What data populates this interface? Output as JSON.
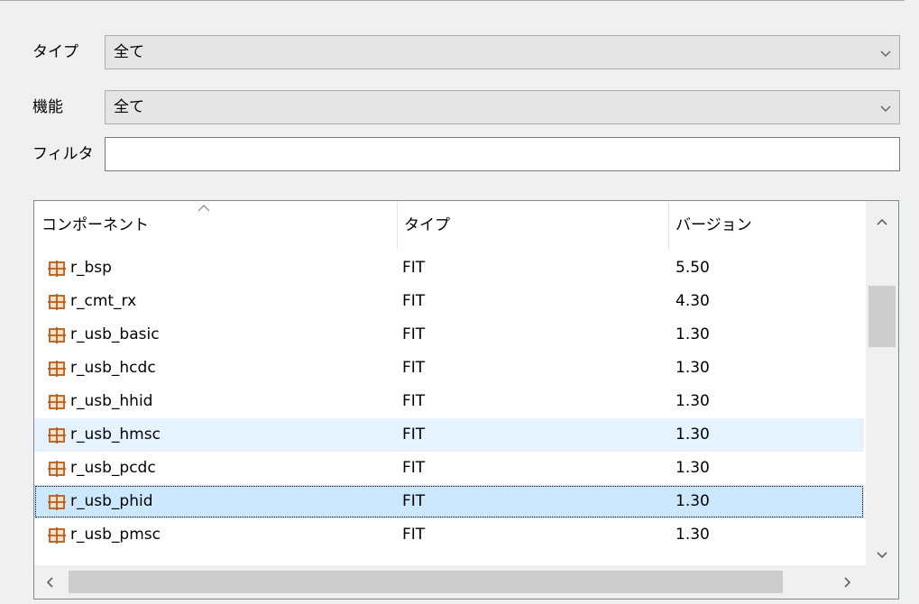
{
  "filters": {
    "type_label": "タイプ",
    "type_value": "全て",
    "function_label": "機能",
    "function_value": "全て",
    "filter_label": "フィルタ",
    "filter_value": ""
  },
  "table": {
    "columns": [
      "コンポーネント",
      "タイプ",
      "バージョン"
    ],
    "rows": [
      {
        "name": "r_bsp",
        "type": "FIT",
        "version": "5.50"
      },
      {
        "name": "r_cmt_rx",
        "type": "FIT",
        "version": "4.30"
      },
      {
        "name": "r_usb_basic",
        "type": "FIT",
        "version": "1.30"
      },
      {
        "name": "r_usb_hcdc",
        "type": "FIT",
        "version": "1.30"
      },
      {
        "name": "r_usb_hhid",
        "type": "FIT",
        "version": "1.30"
      },
      {
        "name": "r_usb_hmsc",
        "type": "FIT",
        "version": "1.30"
      },
      {
        "name": "r_usb_pcdc",
        "type": "FIT",
        "version": "1.30"
      },
      {
        "name": "r_usb_phid",
        "type": "FIT",
        "version": "1.30"
      },
      {
        "name": "r_usb_pmsc",
        "type": "FIT",
        "version": "1.30"
      }
    ],
    "hovered_row": "r_usb_hmsc",
    "selected_row": "r_usb_phid",
    "row_icon": "component-grid-icon"
  },
  "colors": {
    "selection": "#cce8ff",
    "hover": "#e5f3ff",
    "icon": "#b85c1b"
  }
}
